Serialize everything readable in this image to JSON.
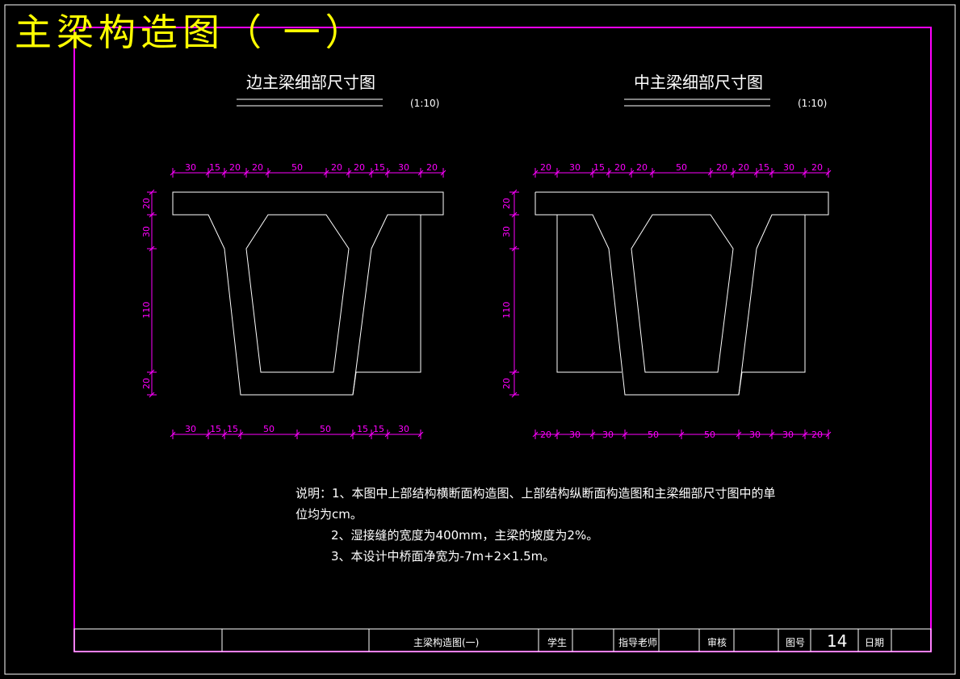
{
  "drawing_title": "主梁构造图（ 一）",
  "views": [
    {
      "title": "边主梁细部尺寸图",
      "scale": "(1:10)"
    },
    {
      "title": "中主梁细部尺寸图",
      "scale": "(1:10)"
    }
  ],
  "dimensions": {
    "left_top": [
      "30",
      "15",
      "20",
      "20",
      "50",
      "20",
      "20",
      "15",
      "30",
      "20"
    ],
    "left_bottom": [
      "30",
      "15",
      "15",
      "50",
      "50",
      "15",
      "15",
      "30"
    ],
    "left_vertical": [
      "20",
      "30",
      "110",
      "20"
    ],
    "right_top": [
      "20",
      "30",
      "15",
      "20",
      "20",
      "50",
      "20",
      "20",
      "15",
      "30",
      "20"
    ],
    "right_bottom": [
      "20",
      "30",
      "30",
      "50",
      "50",
      "30",
      "30",
      "20"
    ],
    "right_vertical": [
      "20",
      "30",
      "110",
      "20"
    ]
  },
  "notes": [
    "说明：1、本图中上部结构横断面构造图、上部结构纵断面构造图和主梁细部尺寸图中的单",
    "位均为cm。",
    "2、湿接缝的宽度为400mm，主梁的坡度为2%。",
    "3、本设计中桥面净宽为-7m+2×1.5m。"
  ],
  "title_block": {
    "drawing_name": "主梁构造图(一)",
    "student_label": "学生",
    "advisor_label": "指导老师",
    "review_label": "审核",
    "number_label": "图号",
    "number_value": "14",
    "date_label": "日期"
  },
  "colors": {
    "frame": "#ff00ff",
    "title": "#ffff00",
    "linework": "#ffffff",
    "dimension": "#ff00ff"
  }
}
